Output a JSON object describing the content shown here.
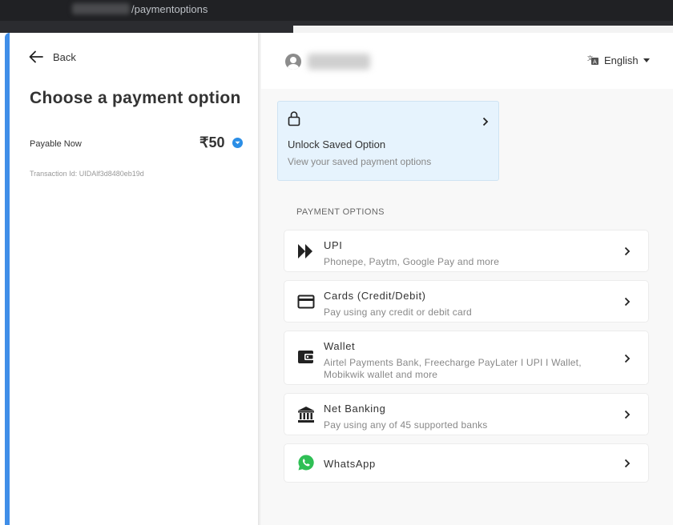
{
  "browser": {
    "url_path": "/paymentoptions"
  },
  "left": {
    "back_label": "Back",
    "title": "Choose a payment option",
    "payable_label": "Payable Now",
    "amount": "₹50",
    "transaction_id": "Transaction Id: UIDAlf3d8480eb19d"
  },
  "header": {
    "language": "English"
  },
  "unlock": {
    "title": "Unlock Saved Option",
    "subtitle": "View your saved payment options"
  },
  "payment_section_label": "PAYMENT OPTIONS",
  "options": [
    {
      "title": "UPI",
      "subtitle": "Phonepe, Paytm, Google Pay and more",
      "icon": "upi-icon"
    },
    {
      "title": "Cards (Credit/Debit)",
      "subtitle": "Pay using any credit or debit card",
      "icon": "card-icon"
    },
    {
      "title": "Wallet",
      "subtitle": "Airtel Payments Bank, Freecharge PayLater I UPI I Wallet, Mobikwik wallet and more",
      "icon": "wallet-icon"
    },
    {
      "title": "Net Banking",
      "subtitle": "Pay using any of 45 supported banks",
      "icon": "bank-icon"
    },
    {
      "title": "WhatsApp",
      "subtitle": "",
      "icon": "whatsapp-icon"
    }
  ],
  "colors": {
    "accent": "#3f8ee8",
    "unlock_bg": "#e6f3fd",
    "whatsapp": "#2fbf55"
  }
}
